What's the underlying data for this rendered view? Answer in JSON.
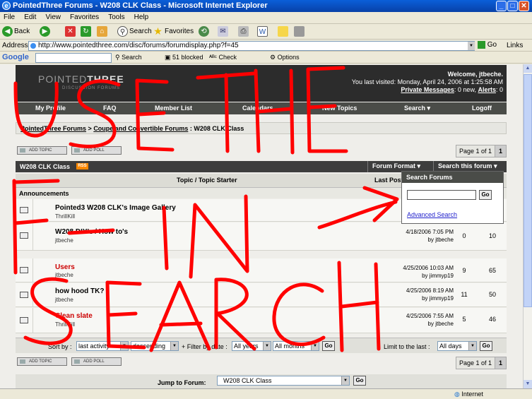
{
  "window": {
    "title": "PointedThree Forums - W208 CLK Class - Microsoft Internet Explorer",
    "minimize": "_",
    "maximize": "□",
    "close": "✕"
  },
  "menu": [
    "File",
    "Edit",
    "View",
    "Favorites",
    "Tools",
    "Help"
  ],
  "toolbar": {
    "back": "Back",
    "search": "Search",
    "favorites": "Favorites"
  },
  "address": {
    "label": "Address",
    "url": "http://www.pointedthree.com/disc/forums/forumdisplay.php?f=45",
    "go": "Go",
    "links": "Links"
  },
  "google_bar": {
    "logo": "Google",
    "search": "Search",
    "blocked": "51 blocked",
    "check": "Check",
    "options": "Options"
  },
  "forum": {
    "logo_main": "POINTED",
    "logo_bold": "THREE",
    "logo_sub": "DISCUSSION FORUMS",
    "welcome": "Welcome, jtbeche.",
    "last_visit": "You last visited: Monday, April 24, 2006 at 1:25:58 AM",
    "pm_label": "Private Messages",
    "pm_text": ": 0 new,",
    "alerts_label": "Alerts",
    "alerts_text": ": 0",
    "nav": [
      "My Profile",
      "FAQ",
      "Member List",
      "Calendars",
      "New Topics",
      "Search ▾",
      "Logoff"
    ],
    "breadcrumb_root": "PointedThree Forums",
    "breadcrumb_sep": ">",
    "breadcrumb_mid": "Coupe and Convertible Forums",
    "breadcrumb_current": ": W208 CLK Class",
    "add_topic": "ADD TOPIC",
    "add_poll": "ADD POLL",
    "page_label": "Page 1 of 1",
    "page_num": "1",
    "forum_title": "W208 CLK Class",
    "rss": "RSS",
    "forum_format": "Forum Format ▾",
    "search_forum": "Search this forum ▾",
    "col_topic": "Topic / Topic Starter",
    "col_last": "Last Post",
    "announcements": "Announcements",
    "search_popup": {
      "heading": "Search Forums",
      "go": "Go",
      "advanced": "Advanced Search"
    },
    "rows": [
      {
        "title": "Pointed3 W208 CLK's Image Gallery",
        "starter": "ThrillKill",
        "last_date": "",
        "last_by": "",
        "replies": "",
        "views": ""
      },
      {
        "title": "W208 DIY's / How to's",
        "starter": "jtbeche",
        "last_date": "4/18/2006 7:05 PM",
        "last_by": "by jtbeche",
        "replies": "0",
        "views": "10"
      },
      {
        "title": "Users",
        "starter": "jtbeche",
        "last_date": "4/25/2006 10:03 AM",
        "last_by": "by jimmyp19",
        "replies": "9",
        "views": "65"
      },
      {
        "title": "how hood TK?",
        "starter": "jtbeche",
        "last_date": "4/25/2006 8:19 AM",
        "last_by": "by jimmyp19",
        "replies": "11",
        "views": "50"
      },
      {
        "title": "Clean slate",
        "starter": "ThrillKill",
        "last_date": "4/25/2006 7:55 AM",
        "last_by": "by jtbeche",
        "replies": "5",
        "views": "46"
      }
    ],
    "sort": {
      "sort_by": "Sort by :",
      "sort_value": "last activity",
      "order_value": "descending",
      "filter_label": "+ Filter by date :",
      "years_value": "All years",
      "months_value": "All months",
      "go": "Go",
      "limit_label": "Limit to the last :",
      "days_value": "All days"
    },
    "jump": {
      "label": "Jump to Forum:",
      "value": "W208 CLK Class",
      "go": "Go"
    }
  },
  "status": {
    "zone": "Internet"
  },
  "annotation": {
    "words": [
      "USE THE",
      "F-IN",
      "SEARCH"
    ],
    "color": "#ff0000"
  }
}
